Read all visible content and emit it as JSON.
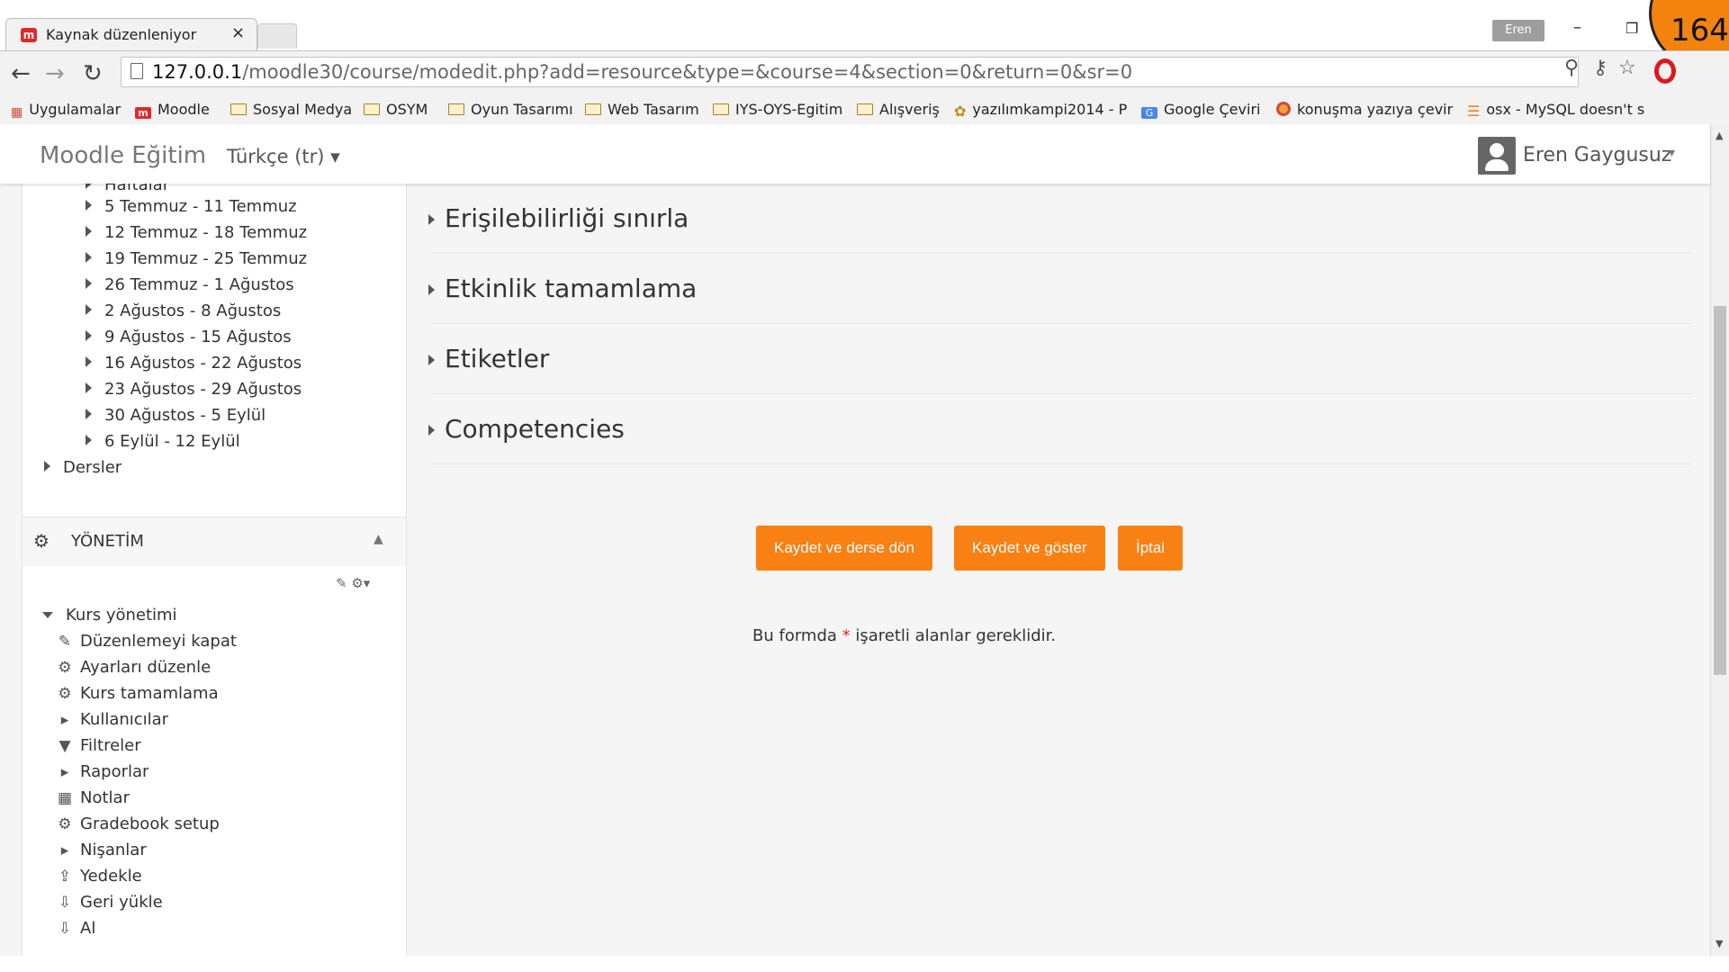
{
  "browser": {
    "tab_title": "Kaynak düzenleniyor",
    "tab_close": "×",
    "profile_name": "Eren",
    "minimize": "–",
    "restore": "❐",
    "badge": "164",
    "url_host": "127.0.0.1",
    "url_path": "/moodle30/course/modedit.php?add=resource&type=&course=4&section=0&return=0&sr=0",
    "back": "←",
    "forward": "→",
    "reload": "↻",
    "bookmarks": [
      {
        "label": "Uygulamalar",
        "icon": "apps-grid-icon"
      },
      {
        "label": "Moodle",
        "icon": "moodle-icon"
      },
      {
        "label": "Sosyal Medya",
        "icon": "folder-icon"
      },
      {
        "label": "OSYM",
        "icon": "folder-icon"
      },
      {
        "label": "Oyun Tasarımı",
        "icon": "folder-icon"
      },
      {
        "label": "Web Tasarım",
        "icon": "folder-icon"
      },
      {
        "label": "IYS-OYS-Egitim",
        "icon": "folder-icon"
      },
      {
        "label": "Alışveriş",
        "icon": "folder-icon"
      },
      {
        "label": "yazılımkampi2014 - P",
        "icon": "site-icon"
      },
      {
        "label": "Google Çeviri",
        "icon": "translate-icon"
      },
      {
        "label": "konuşma yazıya çevir",
        "icon": "chrome-icon"
      },
      {
        "label": "osx - MySQL doesn't s",
        "icon": "stackoverflow-icon"
      }
    ]
  },
  "navbar": {
    "brand": "Moodle Eğitim",
    "language": "Türkçe (tr) ▾",
    "user_name": "Eren Gaygusuz",
    "user_caret": "▾"
  },
  "nav_block": {
    "partial_item": "Haftalar",
    "weeks": [
      "5 Temmuz - 11 Temmuz",
      "12 Temmuz - 18 Temmuz",
      "19 Temmuz - 25 Temmuz",
      "26 Temmuz - 1 Ağustos",
      "2 Ağustos - 8 Ağustos",
      "9 Ağustos - 15 Ağustos",
      "16 Ağustos - 22 Ağustos",
      "23 Ağustos - 29 Ağustos",
      "30 Ağustos - 5 Eylül",
      "6 Eylül - 12 Eylül"
    ],
    "dersler": "Dersler"
  },
  "admin_block": {
    "title": "YÖNETİM",
    "gears_icon": "⚙",
    "collapse": "▲",
    "tools": "✎  ⚙▾",
    "root": "Kurs yönetimi",
    "items": [
      {
        "label": "Düzenlemeyi kapat",
        "icon": "✎",
        "icon_name": "pencil-icon"
      },
      {
        "label": "Ayarları düzenle",
        "icon": "⚙",
        "icon_name": "gear-icon"
      },
      {
        "label": "Kurs tamamlama",
        "icon": "⚙",
        "icon_name": "gear-icon"
      },
      {
        "label": "Kullanıcılar",
        "icon": "▸",
        "icon_name": "expand-icon"
      },
      {
        "label": "Filtreler",
        "icon": "▼",
        "icon_name": "filter-icon"
      },
      {
        "label": "Raporlar",
        "icon": "▸",
        "icon_name": "expand-icon"
      },
      {
        "label": "Notlar",
        "icon": "▦",
        "icon_name": "grades-icon"
      },
      {
        "label": "Gradebook setup",
        "icon": "⚙",
        "icon_name": "gear-icon"
      },
      {
        "label": "Nişanlar",
        "icon": "▸",
        "icon_name": "expand-icon"
      },
      {
        "label": "Yedekle",
        "icon": "⇪",
        "icon_name": "backup-icon"
      },
      {
        "label": "Geri yükle",
        "icon": "⇩",
        "icon_name": "restore-icon"
      },
      {
        "label": "Al",
        "icon": "⇩",
        "icon_name": "import-icon"
      }
    ]
  },
  "form": {
    "sections": [
      "Erişilebilirliği sınırla",
      "Etkinlik tamamlama",
      "Etiketler",
      "Competencies"
    ],
    "buttons": {
      "save_return": "Kaydet ve derse dön",
      "save_display": "Kaydet ve göster",
      "cancel": "İptal"
    },
    "required_before": "Bu formda ",
    "required_star": "*",
    "required_after": " işaretli alanlar gereklidir."
  },
  "colors": {
    "accent": "#f98012",
    "required": "#e2272a"
  }
}
